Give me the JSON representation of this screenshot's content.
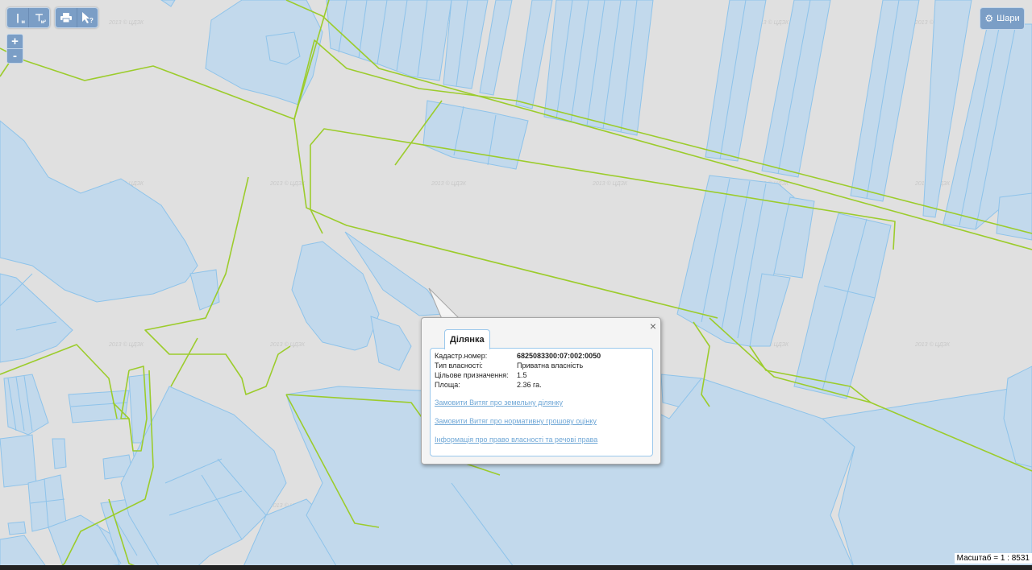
{
  "toolbar": {
    "measure_sub": "м",
    "area_sub": "м²",
    "print_icon": "printer-icon",
    "identify_icon": "cursor-question-icon"
  },
  "zoom": {
    "in_label": "+",
    "out_label": "-"
  },
  "layers_button": {
    "label": "Шари",
    "icon": "gear-icon"
  },
  "watermark": "2013 © ЦДЗК",
  "popup": {
    "tab": "Ділянка",
    "close": "×",
    "rows": [
      {
        "key": "Кадастр.номер:",
        "value": "6825083300:07:002:0050"
      },
      {
        "key": "Тип власності:",
        "value": "Приватна власність"
      },
      {
        "key": "Цільове призначення:",
        "value": "1.5"
      },
      {
        "key": "Площа:",
        "value": "2.36 га."
      }
    ],
    "links": [
      "Замовити Витяг про земельну ділянку",
      "Замовити Витяг про нормативну грошову оцінку",
      "Інформація про право власності та речові права"
    ]
  },
  "scale": "Масштаб = 1 : 8531",
  "colors": {
    "parcel_fill": "#c2d9ec",
    "parcel_stroke": "#8ec3ea",
    "boundary": "#9ccc2c",
    "background": "#e0e0e0",
    "toolbar": "#7b9ec6"
  }
}
